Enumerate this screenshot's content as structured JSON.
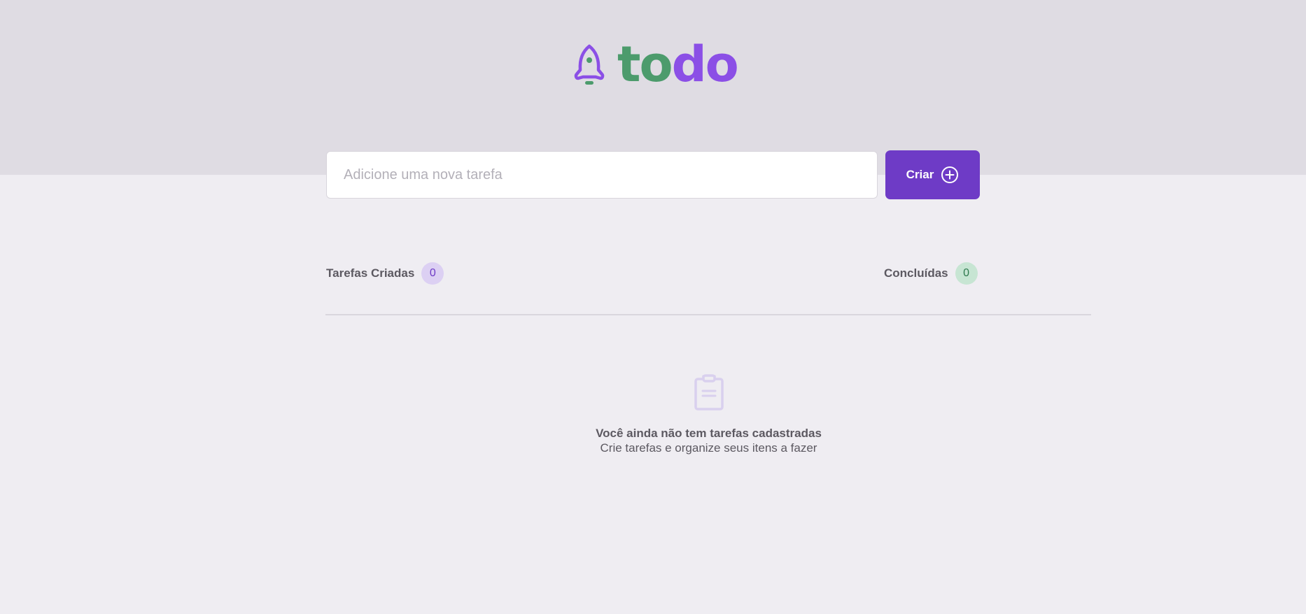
{
  "header": {
    "logo_part1": "to",
    "logo_part2": "do",
    "logo_icon": "rocket-icon",
    "colors": {
      "green": "#4C9B6C",
      "purple": "#8B4FE6"
    }
  },
  "new_task": {
    "placeholder": "Adicione uma nova tarefa",
    "value": "",
    "create_label": "Criar",
    "create_icon": "plus-circle-icon"
  },
  "counters": {
    "created_label": "Tarefas Criadas",
    "created_count": "0",
    "done_label": "Concluídas",
    "done_count": "0"
  },
  "empty_state": {
    "icon": "clipboard-icon",
    "title": "Você ainda não tem tarefas cadastradas",
    "subtitle": "Crie tarefas e organize seus itens a fazer"
  }
}
